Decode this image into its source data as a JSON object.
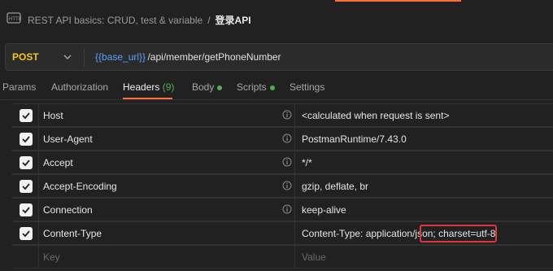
{
  "breadcrumb": {
    "collection": "REST API basics: CRUD, test & variable",
    "separator": "/",
    "request": "登录API"
  },
  "request": {
    "method": "POST",
    "url_variable": "{{base_url}}",
    "url_path": "/api/member/getPhoneNumber"
  },
  "tabs": [
    {
      "label": "Params"
    },
    {
      "label": "Authorization"
    },
    {
      "label": "Headers",
      "count": "(9)"
    },
    {
      "label": "Body"
    },
    {
      "label": "Scripts"
    },
    {
      "label": "Settings"
    }
  ],
  "headers": [
    {
      "key": "Host",
      "value": "<calculated when request is sent>"
    },
    {
      "key": "User-Agent",
      "value": "PostmanRuntime/7.43.0"
    },
    {
      "key": "Accept",
      "value": "*/*"
    },
    {
      "key": "Accept-Encoding",
      "value": "gzip, deflate, br"
    },
    {
      "key": "Connection",
      "value": "keep-alive"
    },
    {
      "key": "Content-Type",
      "value": "Content-Type: application/json; charset=utf-8"
    }
  ],
  "new_row": {
    "key_placeholder": "Key",
    "value_placeholder": "Value"
  },
  "colors": {
    "accent": "#ff6c37",
    "method": "#f5c518",
    "variable": "#5aa0ff",
    "highlight": "#e0343e",
    "status_dot": "#4caf50"
  }
}
